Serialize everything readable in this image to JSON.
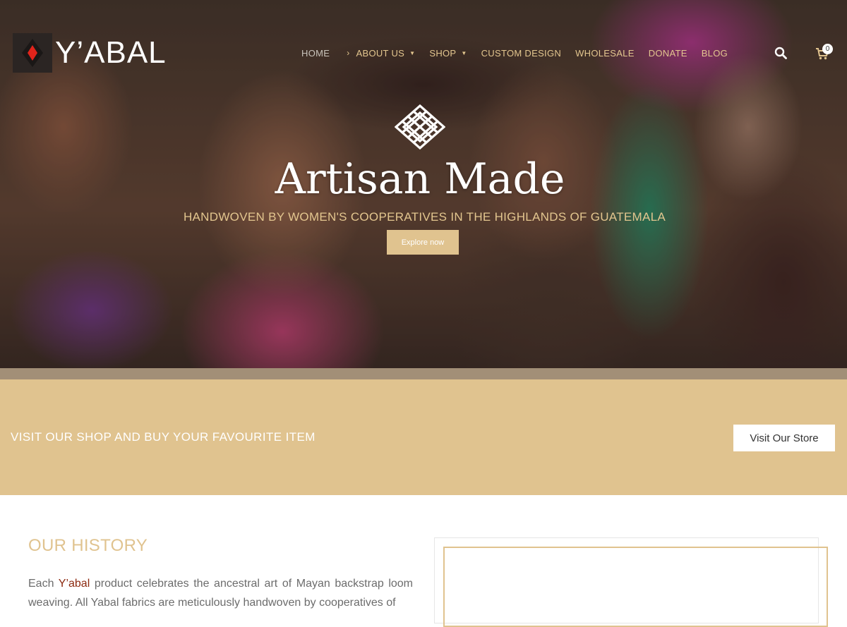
{
  "header": {
    "logo_text": "Y’ABAL",
    "nav": [
      {
        "label": "HOME"
      },
      {
        "label": "ABOUT US"
      },
      {
        "label": "SHOP"
      },
      {
        "label": "CUSTOM DESIGN"
      },
      {
        "label": "WHOLESALE"
      },
      {
        "label": "DONATE"
      },
      {
        "label": "BLOG"
      }
    ],
    "cart_count": "0"
  },
  "hero": {
    "title": "Artisan Made",
    "subtitle": "HANDWOVEN BY WOMEN'S COOPERATIVES IN THE HIGHLANDS OF GUATEMALA",
    "button_label": "Explore now"
  },
  "cta": {
    "text": "VISIT OUR SHOP AND BUY YOUR FAVOURITE ITEM",
    "button_label": "Visit Our Store"
  },
  "history": {
    "title": "OUR HISTORY",
    "body_prefix": "Each ",
    "brand": "Y’abal",
    "body_suffix": " product celebrates the ancestral art of Mayan backstrap loom weaving. All Yabal fabrics are meticulously handwoven by cooperatives of"
  },
  "colors": {
    "accent": "#e0c38f",
    "brand_text": "#8c2a10",
    "logo_diamond": "#e0241b"
  }
}
